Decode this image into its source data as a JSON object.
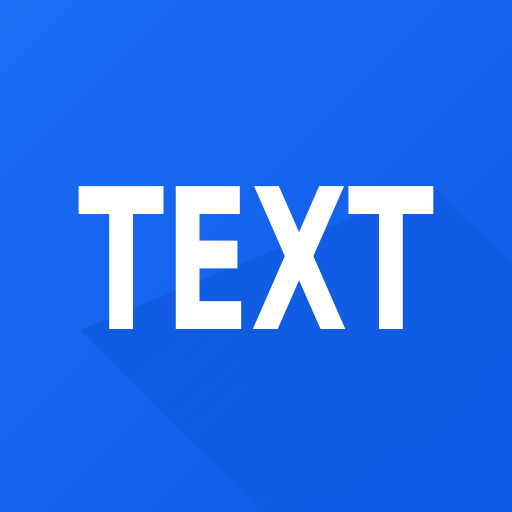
{
  "icon": {
    "name": "text-app-icon",
    "label": "TEXT",
    "colors": {
      "background": "#1565ee",
      "background_light": "#1a6ef5",
      "background_dark": "#0d5ae6",
      "shadow": "#0a4fcf",
      "text": "#ffffff"
    }
  }
}
